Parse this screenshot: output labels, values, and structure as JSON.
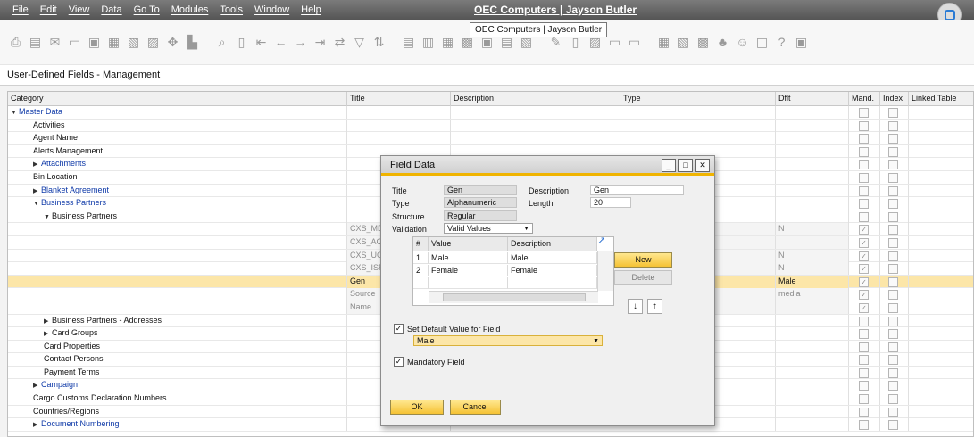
{
  "menu": [
    "File",
    "Edit",
    "View",
    "Data",
    "Go To",
    "Modules",
    "Tools",
    "Window",
    "Help"
  ],
  "app_title": "OEC Computers | Jayson Butler",
  "tooltip": "OEC Computers | Jayson Butler",
  "window_title": "User-Defined Fields - Management",
  "grid": {
    "headers": [
      "Category",
      "Title",
      "Description",
      "Type",
      "Dflt",
      "Mand.",
      "Index",
      "Linked Table"
    ],
    "rows": [
      {
        "level": 0,
        "expand": "open",
        "link": true,
        "category": "Master Data",
        "title": "",
        "dflt": "",
        "mand": false,
        "grey": false
      },
      {
        "level": 1,
        "expand": "",
        "link": false,
        "category": "Activities",
        "title": "",
        "dflt": "",
        "mand": false,
        "grey": false
      },
      {
        "level": 1,
        "expand": "",
        "link": false,
        "category": "Agent Name",
        "title": "",
        "dflt": "",
        "mand": false,
        "grey": false
      },
      {
        "level": 1,
        "expand": "",
        "link": false,
        "category": "Alerts Management",
        "title": "",
        "dflt": "",
        "mand": false,
        "grey": false
      },
      {
        "level": 1,
        "expand": "closed",
        "link": true,
        "category": "Attachments",
        "title": "",
        "dflt": "",
        "mand": false,
        "grey": false
      },
      {
        "level": 1,
        "expand": "",
        "link": false,
        "category": "Bin Location",
        "title": "",
        "dflt": "",
        "mand": false,
        "grey": false
      },
      {
        "level": 1,
        "expand": "closed",
        "link": true,
        "category": "Blanket Agreement",
        "title": "",
        "dflt": "",
        "mand": false,
        "grey": false
      },
      {
        "level": 1,
        "expand": "open",
        "link": true,
        "category": "Business Partners",
        "title": "",
        "dflt": "",
        "mand": false,
        "grey": false
      },
      {
        "level": 2,
        "expand": "open",
        "link": false,
        "category": "Business Partners",
        "title": "",
        "dflt": "",
        "mand": false,
        "grey": false
      },
      {
        "level": 3,
        "expand": "",
        "link": false,
        "category": "",
        "title": "CXS_MD",
        "dflt": "N",
        "mand": true,
        "grey": true
      },
      {
        "level": 3,
        "expand": "",
        "link": false,
        "category": "",
        "title": "CXS_AC",
        "dflt": "",
        "mand": true,
        "grey": true
      },
      {
        "level": 3,
        "expand": "",
        "link": false,
        "category": "",
        "title": "CXS_UC",
        "dflt": "N",
        "mand": true,
        "grey": true
      },
      {
        "level": 3,
        "expand": "",
        "link": false,
        "category": "",
        "title": "CXS_ISR",
        "dflt": "N",
        "mand": true,
        "grey": true
      },
      {
        "level": 3,
        "expand": "",
        "link": false,
        "category": "",
        "title": "Gen",
        "dflt": "Male",
        "mand": true,
        "grey": true,
        "selected": true
      },
      {
        "level": 3,
        "expand": "",
        "link": false,
        "category": "",
        "title": "Source",
        "dflt": "media",
        "mand": true,
        "grey": true
      },
      {
        "level": 3,
        "expand": "",
        "link": false,
        "category": "",
        "title": "Name",
        "dflt": "",
        "mand": true,
        "grey": true
      },
      {
        "level": 2,
        "expand": "closed",
        "link": false,
        "category": "Business Partners - Addresses",
        "title": "",
        "dflt": "",
        "mand": false,
        "grey": false
      },
      {
        "level": 2,
        "expand": "closed",
        "link": false,
        "category": "Card Groups",
        "title": "",
        "dflt": "",
        "mand": false,
        "grey": false
      },
      {
        "level": 2,
        "expand": "",
        "link": false,
        "category": "Card Properties",
        "title": "",
        "dflt": "",
        "mand": false,
        "grey": false
      },
      {
        "level": 2,
        "expand": "",
        "link": false,
        "category": "Contact Persons",
        "title": "",
        "dflt": "",
        "mand": false,
        "grey": false
      },
      {
        "level": 2,
        "expand": "",
        "link": false,
        "category": "Payment Terms",
        "title": "",
        "dflt": "",
        "mand": false,
        "grey": false
      },
      {
        "level": 1,
        "expand": "closed",
        "link": true,
        "category": "Campaign",
        "title": "",
        "dflt": "",
        "mand": false,
        "grey": false
      },
      {
        "level": 1,
        "expand": "",
        "link": false,
        "category": "Cargo Customs Declaration Numbers",
        "title": "",
        "dflt": "",
        "mand": false,
        "grey": false
      },
      {
        "level": 1,
        "expand": "",
        "link": false,
        "category": "Countries/Regions",
        "title": "",
        "dflt": "",
        "mand": false,
        "grey": false
      },
      {
        "level": 1,
        "expand": "closed",
        "link": true,
        "category": "Document Numbering",
        "title": "",
        "dflt": "",
        "mand": false,
        "grey": false
      }
    ]
  },
  "dialog": {
    "title": "Field Data",
    "labels": {
      "title": "Title",
      "type": "Type",
      "structure": "Structure",
      "validation": "Validation",
      "description": "Description",
      "length": "Length"
    },
    "values": {
      "title": "Gen",
      "type": "Alphanumeric",
      "structure": "Regular",
      "validation": "Valid Values",
      "description": "Gen",
      "length": "20"
    },
    "matrix": {
      "headers": [
        "#",
        "Value",
        "Description"
      ],
      "rows": [
        {
          "num": "1",
          "value": "Male",
          "desc": "Male"
        },
        {
          "num": "2",
          "value": "Female",
          "desc": "Female"
        }
      ]
    },
    "new_label": "New",
    "delete_label": "Delete",
    "default_check_label": "Set Default Value for Field",
    "default_value": "Male",
    "mandatory_label": "Mandatory Field",
    "ok_label": "OK",
    "cancel_label": "Cancel"
  },
  "colors": {
    "selection": "#fce6a8",
    "accent": "#f5c234",
    "link": "#0f3aa8"
  }
}
